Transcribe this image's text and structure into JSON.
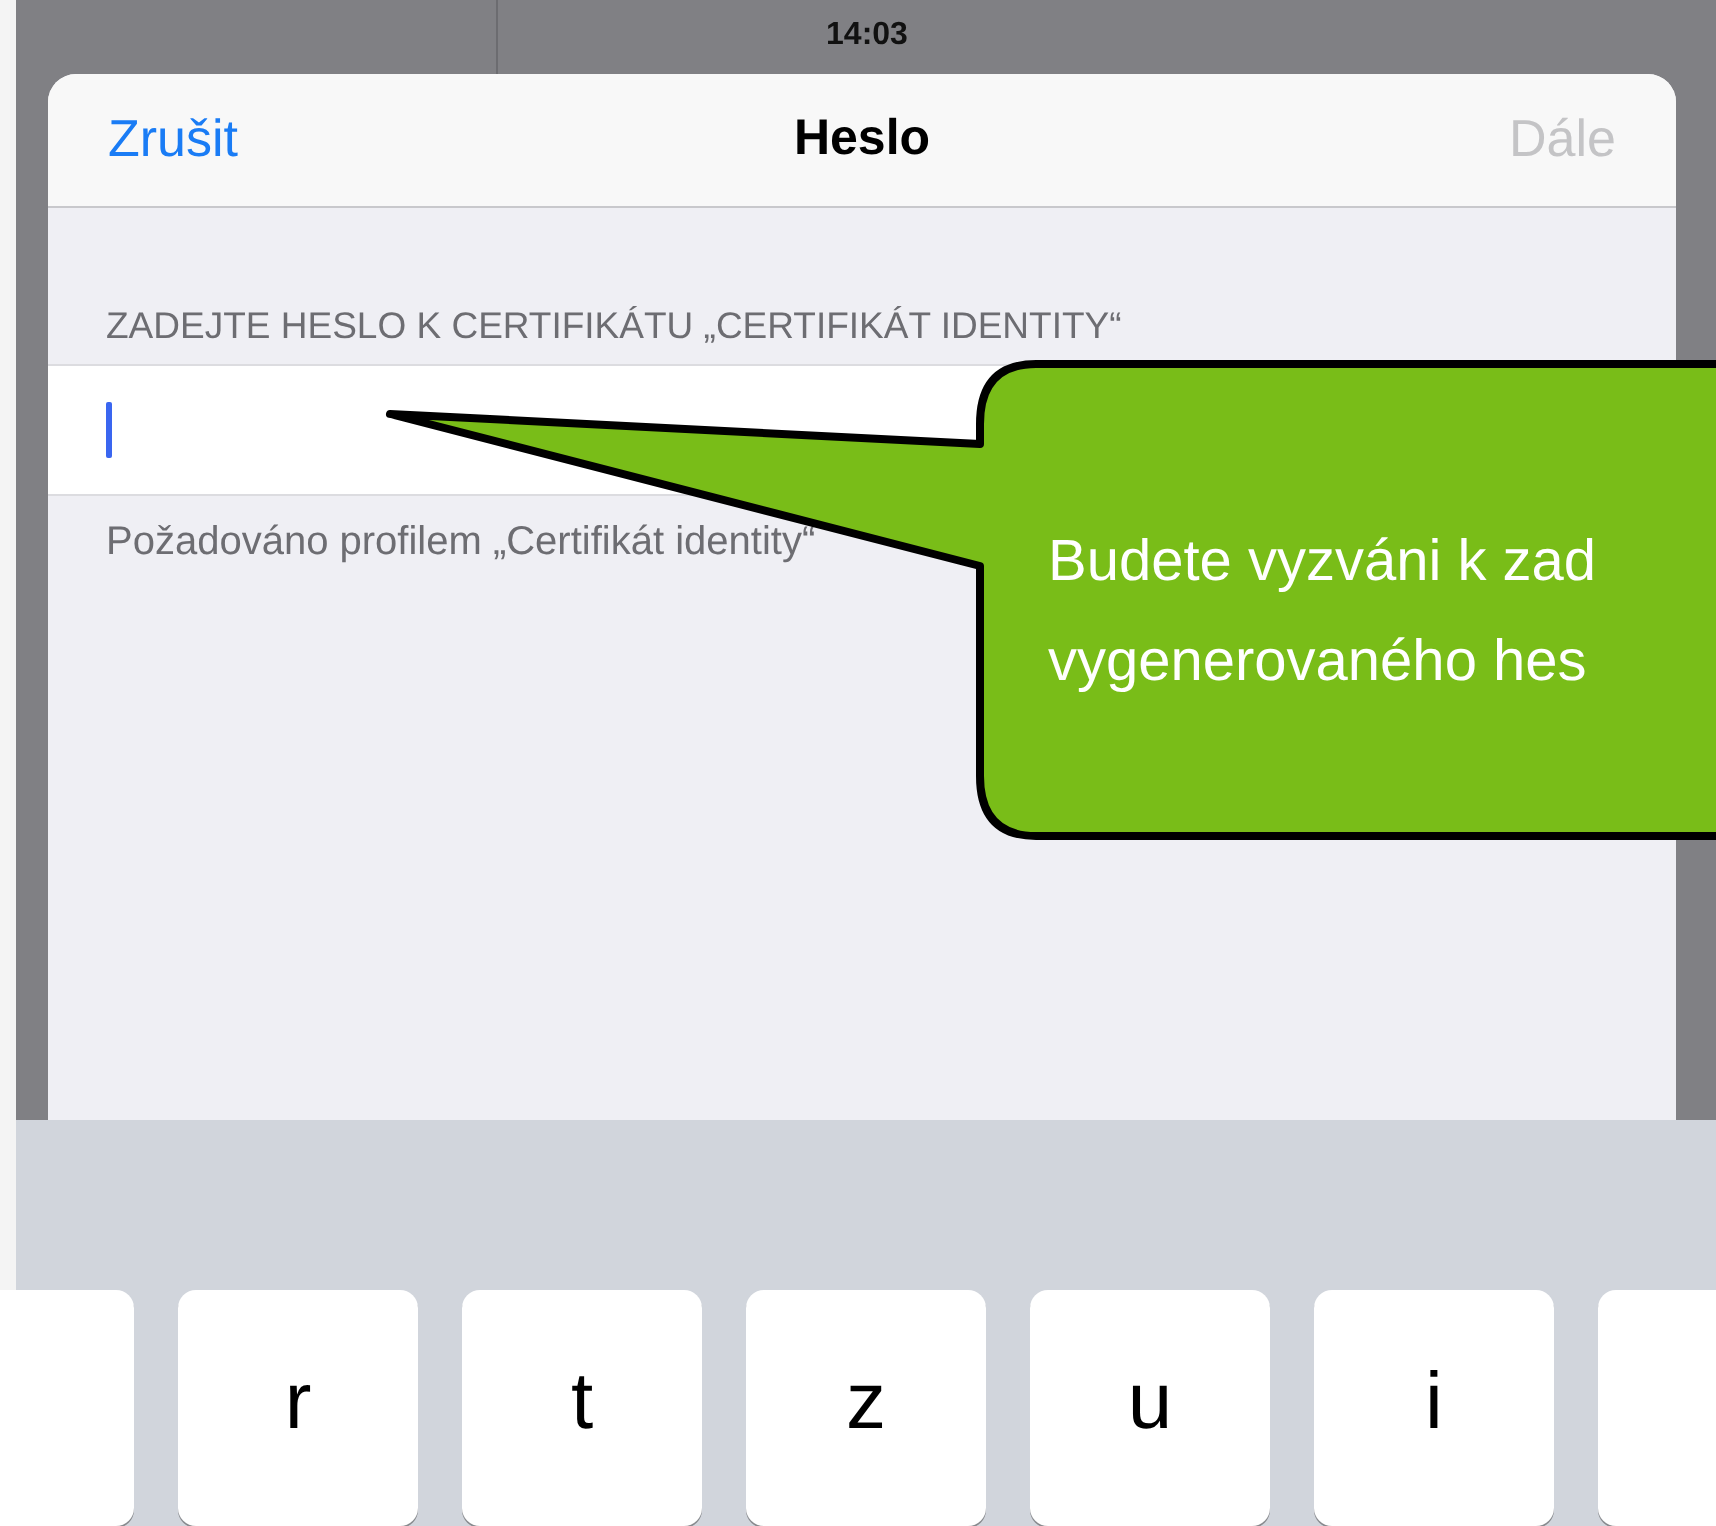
{
  "status_bar": {
    "time": "14:03"
  },
  "dialog": {
    "title": "Heslo",
    "cancel": {
      "label": "Zrušit",
      "disabled": false
    },
    "next": {
      "label": "Dále",
      "disabled": true
    },
    "section_label": "ZADEJTE HESLO K CERTIFIKÁTU „CERTIFIKÁT IDENTITY“",
    "password_field": {
      "focused": true
    },
    "footer": "Požadováno profilem „Certifikát identity“"
  },
  "callout": {
    "lines": [
      "Budete vyzváni k zad",
      "vygenerovaného hes"
    ]
  },
  "keyboard": {
    "keys": [
      {
        "kind": "partial"
      },
      {
        "kind": "letter",
        "label": "r"
      },
      {
        "kind": "letter",
        "label": "t"
      },
      {
        "kind": "letter",
        "label": "z"
      },
      {
        "kind": "letter",
        "label": "u"
      },
      {
        "kind": "letter",
        "label": "i"
      },
      {
        "kind": "partial"
      }
    ]
  }
}
